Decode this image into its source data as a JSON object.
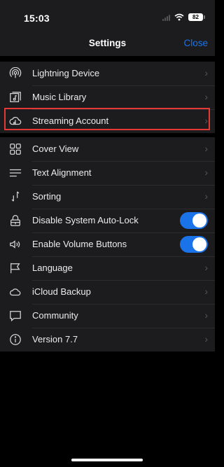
{
  "status_bar": {
    "time": "15:03",
    "battery": "82"
  },
  "nav": {
    "title": "Settings",
    "close_label": "Close"
  },
  "groups": [
    {
      "items": [
        {
          "label": "Lightning Device",
          "icon": "broadcast-icon",
          "chevron": "›"
        },
        {
          "label": "Music Library",
          "icon": "music-library-icon",
          "chevron": "›"
        },
        {
          "label": "Streaming Account",
          "icon": "cloud-music-icon",
          "chevron": "›",
          "highlighted": true
        }
      ]
    },
    {
      "items": [
        {
          "label": "Cover View",
          "icon": "grid-icon",
          "chevron": "›"
        },
        {
          "label": "Text Alignment",
          "icon": "align-icon",
          "chevron": "›"
        },
        {
          "label": "Sorting",
          "icon": "sort-icon",
          "chevron": "›"
        },
        {
          "label": "Disable System Auto-Lock",
          "icon": "lock-icon",
          "toggle": true
        },
        {
          "label": "Enable Volume Buttons",
          "icon": "speaker-icon",
          "toggle": true
        },
        {
          "label": "Language",
          "icon": "flag-icon",
          "chevron": "›"
        },
        {
          "label": "iCloud Backup",
          "icon": "cloud-icon",
          "chevron": "›"
        },
        {
          "label": "Community",
          "icon": "chat-bubble-icon",
          "chevron": "›"
        },
        {
          "label": "Version 7.7",
          "icon": "info-icon",
          "chevron": "›"
        }
      ]
    }
  ],
  "colors": {
    "accent": "#1a73e8",
    "highlight": "#e53935",
    "background": "#000000",
    "row_background": "#1c1c1e"
  }
}
